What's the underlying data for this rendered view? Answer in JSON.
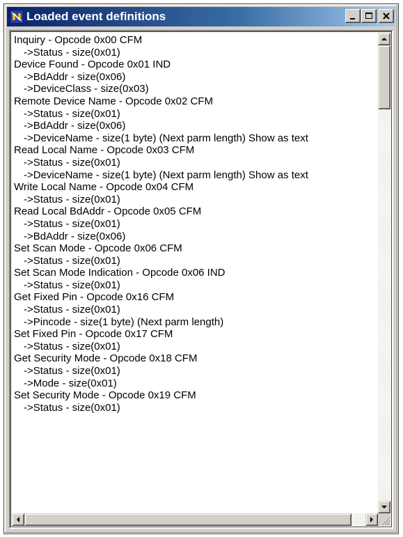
{
  "window": {
    "title": "Loaded event definitions",
    "accent_color": "#0a246a",
    "icons": {
      "app": "app-icon",
      "minimize": "minimize-icon",
      "maximize": "maximize-icon",
      "close": "close-icon"
    }
  },
  "list": {
    "lines": [
      {
        "text": "Inquiry - Opcode 0x00 CFM",
        "indent": false
      },
      {
        "text": "->Status - size(0x01)",
        "indent": true
      },
      {
        "text": "Device Found - Opcode 0x01 IND",
        "indent": false
      },
      {
        "text": "->BdAddr - size(0x06)",
        "indent": true
      },
      {
        "text": "->DeviceClass - size(0x03)",
        "indent": true
      },
      {
        "text": "Remote Device Name - Opcode 0x02 CFM",
        "indent": false
      },
      {
        "text": "->Status - size(0x01)",
        "indent": true
      },
      {
        "text": "->BdAddr - size(0x06)",
        "indent": true
      },
      {
        "text": "->DeviceName - size(1 byte) (Next parm length)  Show as text",
        "indent": true
      },
      {
        "text": "Read Local Name - Opcode 0x03 CFM",
        "indent": false
      },
      {
        "text": "->Status - size(0x01)",
        "indent": true
      },
      {
        "text": "->DeviceName - size(1 byte) (Next parm length)  Show as text",
        "indent": true
      },
      {
        "text": "Write Local Name - Opcode 0x04 CFM",
        "indent": false
      },
      {
        "text": "->Status - size(0x01)",
        "indent": true
      },
      {
        "text": "Read Local BdAddr - Opcode 0x05 CFM",
        "indent": false
      },
      {
        "text": "->Status - size(0x01)",
        "indent": true
      },
      {
        "text": "->BdAddr - size(0x06)",
        "indent": true
      },
      {
        "text": "Set Scan Mode - Opcode 0x06 CFM",
        "indent": false
      },
      {
        "text": "->Status - size(0x01)",
        "indent": true
      },
      {
        "text": "Set Scan Mode Indication - Opcode 0x06 IND",
        "indent": false
      },
      {
        "text": "->Status - size(0x01)",
        "indent": true
      },
      {
        "text": "Get Fixed Pin - Opcode 0x16 CFM",
        "indent": false
      },
      {
        "text": "->Status - size(0x01)",
        "indent": true
      },
      {
        "text": "->Pincode - size(1 byte) (Next parm length)",
        "indent": true
      },
      {
        "text": "Set Fixed Pin - Opcode 0x17 CFM",
        "indent": false
      },
      {
        "text": "->Status - size(0x01)",
        "indent": true
      },
      {
        "text": "Get Security Mode - Opcode 0x18 CFM",
        "indent": false
      },
      {
        "text": "->Status - size(0x01)",
        "indent": true
      },
      {
        "text": "->Mode - size(0x01)",
        "indent": true
      },
      {
        "text": "Set Security Mode - Opcode 0x19 CFM",
        "indent": false
      },
      {
        "text": "->Status - size(0x01)",
        "indent": true
      }
    ]
  },
  "scrollbars": {
    "vertical": {
      "up_icon": "arrow-up-icon",
      "down_icon": "arrow-down-icon",
      "position": 0
    },
    "horizontal": {
      "left_icon": "arrow-left-icon",
      "right_icon": "arrow-right-icon",
      "position": 0
    }
  }
}
